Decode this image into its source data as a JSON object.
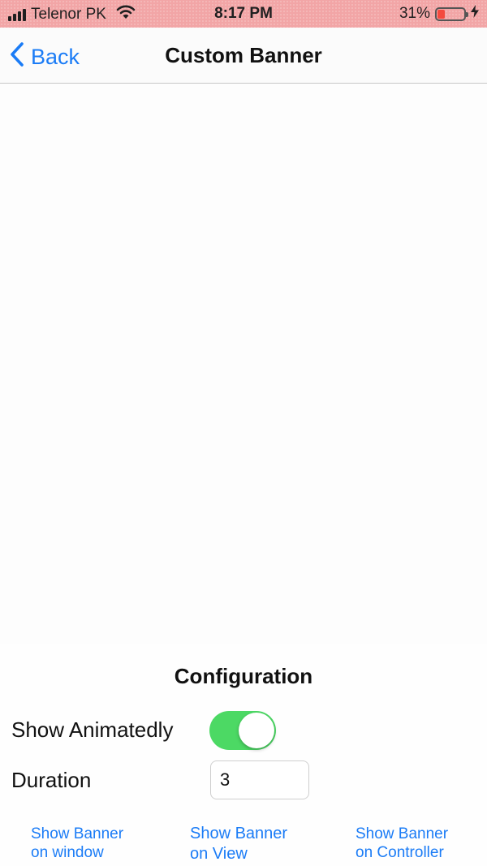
{
  "status_bar": {
    "carrier": "Telenor PK",
    "time": "8:17 PM",
    "battery_percent": "31%",
    "battery_level": 0.31,
    "icons": [
      "signal-icon",
      "wifi-icon",
      "battery-icon",
      "charging-icon"
    ],
    "background_color": "#f2a5a6"
  },
  "nav": {
    "back_label": "Back",
    "title": "Custom Banner",
    "accent_color": "#1b7cf6"
  },
  "config": {
    "title": "Configuration",
    "show_animated_label": "Show Animatedly",
    "show_animated_on": true,
    "toggle_color": "#4cd964",
    "duration_label": "Duration",
    "duration_value": "3"
  },
  "actions": {
    "window": {
      "line1": "Show Banner",
      "line2": "on window"
    },
    "view": {
      "line1": "Show Banner",
      "line2": "on View"
    },
    "controller": {
      "line1": "Show Banner",
      "line2": "on Controller"
    }
  }
}
